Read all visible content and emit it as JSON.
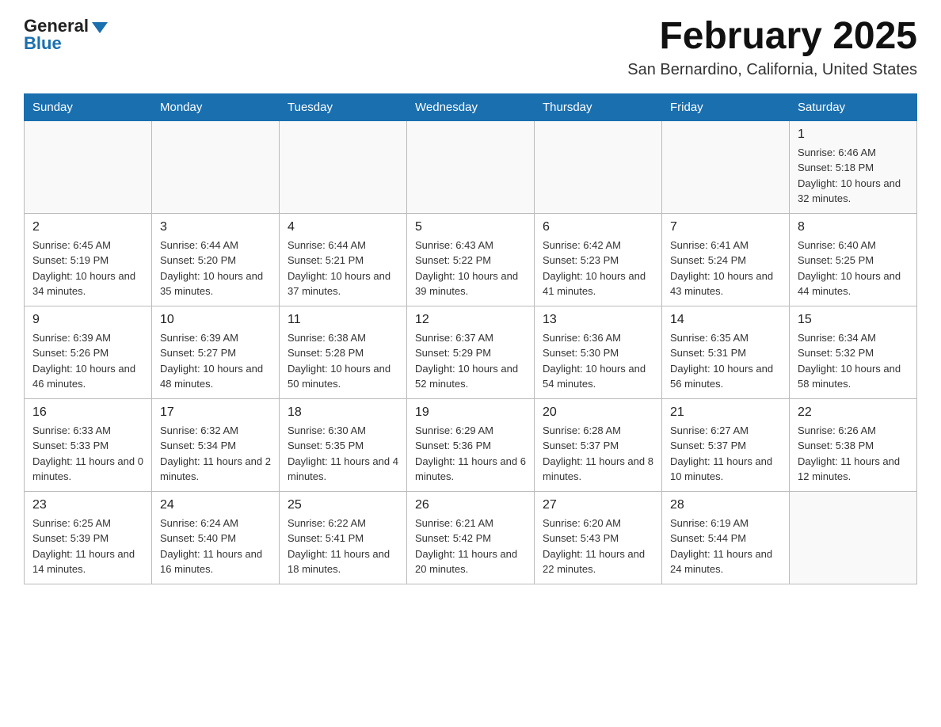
{
  "header": {
    "logo_general": "General",
    "logo_blue": "Blue",
    "month_title": "February 2025",
    "subtitle": "San Bernardino, California, United States"
  },
  "days_of_week": [
    "Sunday",
    "Monday",
    "Tuesday",
    "Wednesday",
    "Thursday",
    "Friday",
    "Saturday"
  ],
  "weeks": [
    [
      {
        "day": "",
        "sunrise": "",
        "sunset": "",
        "daylight": ""
      },
      {
        "day": "",
        "sunrise": "",
        "sunset": "",
        "daylight": ""
      },
      {
        "day": "",
        "sunrise": "",
        "sunset": "",
        "daylight": ""
      },
      {
        "day": "",
        "sunrise": "",
        "sunset": "",
        "daylight": ""
      },
      {
        "day": "",
        "sunrise": "",
        "sunset": "",
        "daylight": ""
      },
      {
        "day": "",
        "sunrise": "",
        "sunset": "",
        "daylight": ""
      },
      {
        "day": "1",
        "sunrise": "Sunrise: 6:46 AM",
        "sunset": "Sunset: 5:18 PM",
        "daylight": "Daylight: 10 hours and 32 minutes."
      }
    ],
    [
      {
        "day": "2",
        "sunrise": "Sunrise: 6:45 AM",
        "sunset": "Sunset: 5:19 PM",
        "daylight": "Daylight: 10 hours and 34 minutes."
      },
      {
        "day": "3",
        "sunrise": "Sunrise: 6:44 AM",
        "sunset": "Sunset: 5:20 PM",
        "daylight": "Daylight: 10 hours and 35 minutes."
      },
      {
        "day": "4",
        "sunrise": "Sunrise: 6:44 AM",
        "sunset": "Sunset: 5:21 PM",
        "daylight": "Daylight: 10 hours and 37 minutes."
      },
      {
        "day": "5",
        "sunrise": "Sunrise: 6:43 AM",
        "sunset": "Sunset: 5:22 PM",
        "daylight": "Daylight: 10 hours and 39 minutes."
      },
      {
        "day": "6",
        "sunrise": "Sunrise: 6:42 AM",
        "sunset": "Sunset: 5:23 PM",
        "daylight": "Daylight: 10 hours and 41 minutes."
      },
      {
        "day": "7",
        "sunrise": "Sunrise: 6:41 AM",
        "sunset": "Sunset: 5:24 PM",
        "daylight": "Daylight: 10 hours and 43 minutes."
      },
      {
        "day": "8",
        "sunrise": "Sunrise: 6:40 AM",
        "sunset": "Sunset: 5:25 PM",
        "daylight": "Daylight: 10 hours and 44 minutes."
      }
    ],
    [
      {
        "day": "9",
        "sunrise": "Sunrise: 6:39 AM",
        "sunset": "Sunset: 5:26 PM",
        "daylight": "Daylight: 10 hours and 46 minutes."
      },
      {
        "day": "10",
        "sunrise": "Sunrise: 6:39 AM",
        "sunset": "Sunset: 5:27 PM",
        "daylight": "Daylight: 10 hours and 48 minutes."
      },
      {
        "day": "11",
        "sunrise": "Sunrise: 6:38 AM",
        "sunset": "Sunset: 5:28 PM",
        "daylight": "Daylight: 10 hours and 50 minutes."
      },
      {
        "day": "12",
        "sunrise": "Sunrise: 6:37 AM",
        "sunset": "Sunset: 5:29 PM",
        "daylight": "Daylight: 10 hours and 52 minutes."
      },
      {
        "day": "13",
        "sunrise": "Sunrise: 6:36 AM",
        "sunset": "Sunset: 5:30 PM",
        "daylight": "Daylight: 10 hours and 54 minutes."
      },
      {
        "day": "14",
        "sunrise": "Sunrise: 6:35 AM",
        "sunset": "Sunset: 5:31 PM",
        "daylight": "Daylight: 10 hours and 56 minutes."
      },
      {
        "day": "15",
        "sunrise": "Sunrise: 6:34 AM",
        "sunset": "Sunset: 5:32 PM",
        "daylight": "Daylight: 10 hours and 58 minutes."
      }
    ],
    [
      {
        "day": "16",
        "sunrise": "Sunrise: 6:33 AM",
        "sunset": "Sunset: 5:33 PM",
        "daylight": "Daylight: 11 hours and 0 minutes."
      },
      {
        "day": "17",
        "sunrise": "Sunrise: 6:32 AM",
        "sunset": "Sunset: 5:34 PM",
        "daylight": "Daylight: 11 hours and 2 minutes."
      },
      {
        "day": "18",
        "sunrise": "Sunrise: 6:30 AM",
        "sunset": "Sunset: 5:35 PM",
        "daylight": "Daylight: 11 hours and 4 minutes."
      },
      {
        "day": "19",
        "sunrise": "Sunrise: 6:29 AM",
        "sunset": "Sunset: 5:36 PM",
        "daylight": "Daylight: 11 hours and 6 minutes."
      },
      {
        "day": "20",
        "sunrise": "Sunrise: 6:28 AM",
        "sunset": "Sunset: 5:37 PM",
        "daylight": "Daylight: 11 hours and 8 minutes."
      },
      {
        "day": "21",
        "sunrise": "Sunrise: 6:27 AM",
        "sunset": "Sunset: 5:37 PM",
        "daylight": "Daylight: 11 hours and 10 minutes."
      },
      {
        "day": "22",
        "sunrise": "Sunrise: 6:26 AM",
        "sunset": "Sunset: 5:38 PM",
        "daylight": "Daylight: 11 hours and 12 minutes."
      }
    ],
    [
      {
        "day": "23",
        "sunrise": "Sunrise: 6:25 AM",
        "sunset": "Sunset: 5:39 PM",
        "daylight": "Daylight: 11 hours and 14 minutes."
      },
      {
        "day": "24",
        "sunrise": "Sunrise: 6:24 AM",
        "sunset": "Sunset: 5:40 PM",
        "daylight": "Daylight: 11 hours and 16 minutes."
      },
      {
        "day": "25",
        "sunrise": "Sunrise: 6:22 AM",
        "sunset": "Sunset: 5:41 PM",
        "daylight": "Daylight: 11 hours and 18 minutes."
      },
      {
        "day": "26",
        "sunrise": "Sunrise: 6:21 AM",
        "sunset": "Sunset: 5:42 PM",
        "daylight": "Daylight: 11 hours and 20 minutes."
      },
      {
        "day": "27",
        "sunrise": "Sunrise: 6:20 AM",
        "sunset": "Sunset: 5:43 PM",
        "daylight": "Daylight: 11 hours and 22 minutes."
      },
      {
        "day": "28",
        "sunrise": "Sunrise: 6:19 AM",
        "sunset": "Sunset: 5:44 PM",
        "daylight": "Daylight: 11 hours and 24 minutes."
      },
      {
        "day": "",
        "sunrise": "",
        "sunset": "",
        "daylight": ""
      }
    ]
  ]
}
